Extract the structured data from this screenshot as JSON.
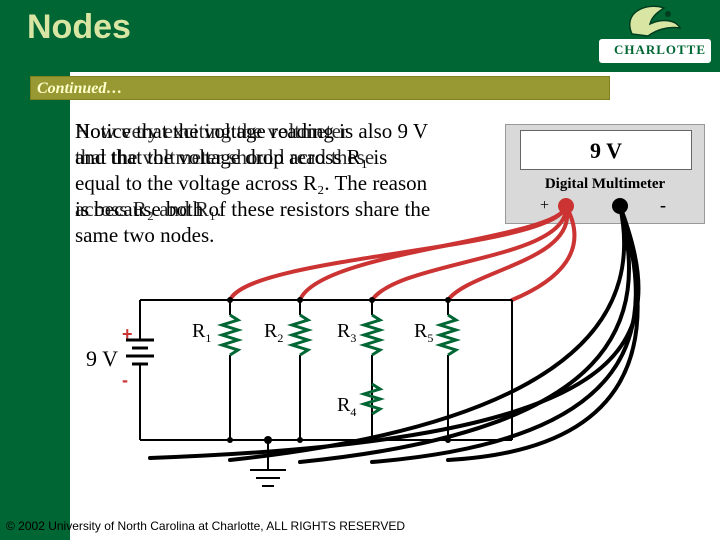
{
  "slide": {
    "title": "Nodes",
    "subtitle": "Continued…",
    "body_lines": [
      "Notice that the voltage reading is also 9 V",
      "and that the voltage drop across R₁ is",
      "equal to the voltage across R₂. The reason",
      "is because both of these resistors share the",
      "same two nodes."
    ],
    "body_overlay_lines": [
      "How very exciting the voltmeter",
      "that the voltmeter should read these",
      "across R₂ and R₁."
    ],
    "copyright": "© 2002 University of North Carolina at Charlotte, ALL RIGHTS RESERVED"
  },
  "logo": {
    "text": "CHARLOTTE"
  },
  "multimeter": {
    "reading": "9 V",
    "label": "Digital Multimeter",
    "positive_terminal": "+",
    "negative_terminal": "-"
  },
  "circuit": {
    "battery": {
      "label": "9 V",
      "plus": "+",
      "minus": "-"
    },
    "resistors": [
      {
        "name": "R",
        "sub": "1"
      },
      {
        "name": "R",
        "sub": "2"
      },
      {
        "name": "R",
        "sub": "3"
      },
      {
        "name": "R",
        "sub": "5"
      },
      {
        "name": "R",
        "sub": "4"
      }
    ]
  },
  "colors": {
    "brand_green": "#006633",
    "title_text": "#d9e6a3",
    "continued_bar": "#999933",
    "probe_red": "#cc3333"
  }
}
